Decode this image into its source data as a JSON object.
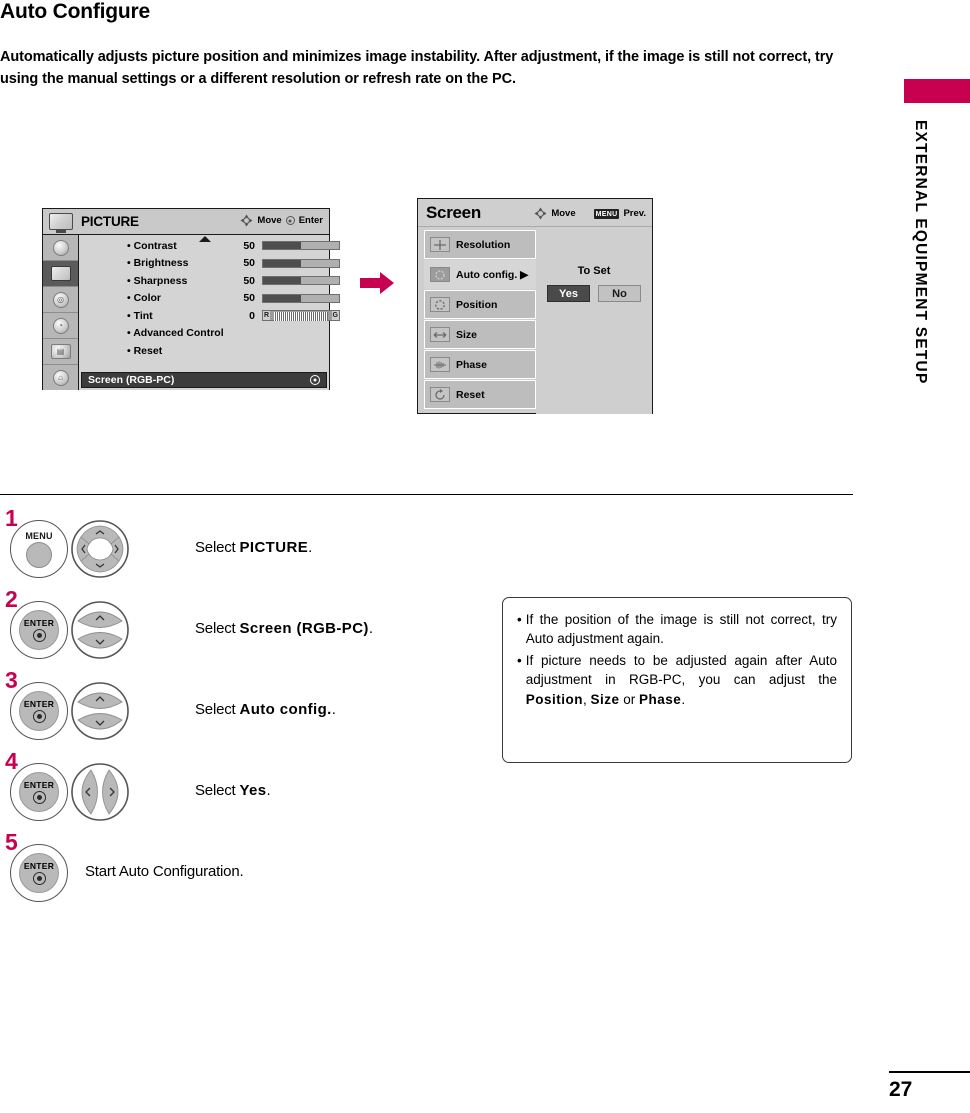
{
  "accent_color": "#c80050",
  "page": {
    "title": "Auto Configure",
    "intro": "Automatically adjusts picture position and minimizes image instability. After adjustment, if the image is still not correct, try using the manual settings or a different resolution or refresh rate on the PC.",
    "chapter_label": "EXTERNAL EQUIPMENT SETUP",
    "page_number": "27"
  },
  "picture_menu": {
    "title": "PICTURE",
    "hints": {
      "move": "Move",
      "enter": "Enter"
    },
    "side_icons": [
      "setup-icon",
      "picture-icon",
      "audio-icon",
      "time-icon",
      "option-icon",
      "lock-icon"
    ],
    "items": [
      {
        "label": "• Contrast",
        "value": "50",
        "bar": 50
      },
      {
        "label": "• Brightness",
        "value": "50",
        "bar": 50
      },
      {
        "label": "• Sharpness",
        "value": "50",
        "bar": 50
      },
      {
        "label": "• Color",
        "value": "50",
        "bar": 50
      },
      {
        "label": "• Tint",
        "value": "0",
        "bar": -1,
        "left_mark": "R",
        "right_mark": "G"
      },
      {
        "label": "• Advanced Control",
        "value": "",
        "bar": -1
      },
      {
        "label": "• Reset",
        "value": "",
        "bar": -1
      }
    ],
    "highlighted_row": "Screen (RGB-PC)"
  },
  "screen_menu": {
    "title": "Screen",
    "hints": {
      "move": "Move",
      "prev": "Prev.",
      "menu_key": "MENU"
    },
    "items": [
      {
        "label": "Resolution",
        "icon": "resolution-icon",
        "selected": false
      },
      {
        "label": "Auto config. ▶",
        "icon": "auto-config-icon",
        "selected": true
      },
      {
        "label": "Position",
        "icon": "position-icon",
        "selected": false
      },
      {
        "label": "Size",
        "icon": "size-icon",
        "selected": false
      },
      {
        "label": "Phase",
        "icon": "phase-icon",
        "selected": false
      },
      {
        "label": "Reset",
        "icon": "reset-icon",
        "selected": false
      }
    ],
    "to_set_label": "To Set",
    "yes_label": "Yes",
    "no_label": "No"
  },
  "steps": [
    {
      "num": "1",
      "button": "MENU",
      "pad": "dpad-4way",
      "text_prefix": "Select ",
      "text_bold": "PICTURE",
      "text_suffix": "."
    },
    {
      "num": "2",
      "button": "ENTER",
      "pad": "updown",
      "text_prefix": "Select ",
      "text_bold": "Screen (RGB-PC)",
      "text_suffix": "."
    },
    {
      "num": "3",
      "button": "ENTER",
      "pad": "updown",
      "text_prefix": "Select ",
      "text_bold": "Auto config.",
      "text_suffix": "."
    },
    {
      "num": "4",
      "button": "ENTER",
      "pad": "leftright",
      "text_prefix": "Select ",
      "text_bold": "Yes",
      "text_suffix": "."
    },
    {
      "num": "5",
      "button": "ENTER",
      "pad": "none",
      "text_prefix": "Start Auto Configuration.",
      "text_bold": "",
      "text_suffix": ""
    }
  ],
  "note": {
    "items": [
      {
        "bullet": "•",
        "part1": "If the position of the image is still not correct, try Auto adjustment again.",
        "bold1": "",
        "part2": "",
        "bold2": "",
        "part3": "",
        "bold3": "",
        "part4": ""
      },
      {
        "bullet": "•",
        "part1": "If picture needs to be adjusted again after Auto adjustment in RGB-PC, you can adjust the ",
        "bold1": "Position",
        "part2": ", ",
        "bold2": "Size",
        "part3": " or ",
        "bold3": "Phase",
        "part4": "."
      }
    ]
  }
}
